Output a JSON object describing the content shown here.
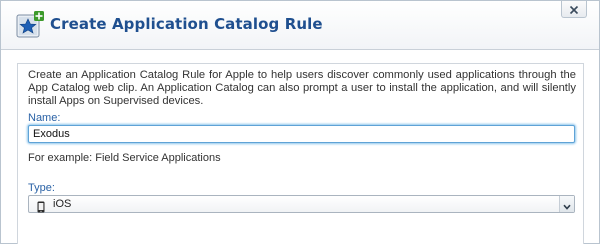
{
  "dialog": {
    "title": "Create Application Catalog Rule",
    "icon": "star-plus-icon",
    "close_icon": "close-icon"
  },
  "form": {
    "description": "Create an Application Catalog Rule for Apple to help users discover commonly used applications through the App Catalog web clip. An Application Catalog can also prompt a user to install the application, and will silently install Apps on Supervised devices.",
    "name_label": "Name:",
    "name_value": "Exodus",
    "example_text": "For example: Field Service Applications",
    "type_label": "Type:",
    "type_value": "iOS",
    "type_icon": "phone-icon",
    "dropdown_icon": "chevron-down-icon"
  },
  "colors": {
    "title": "#1f4f8f",
    "label": "#2a62a6",
    "focus_border": "#5fa3d6"
  }
}
